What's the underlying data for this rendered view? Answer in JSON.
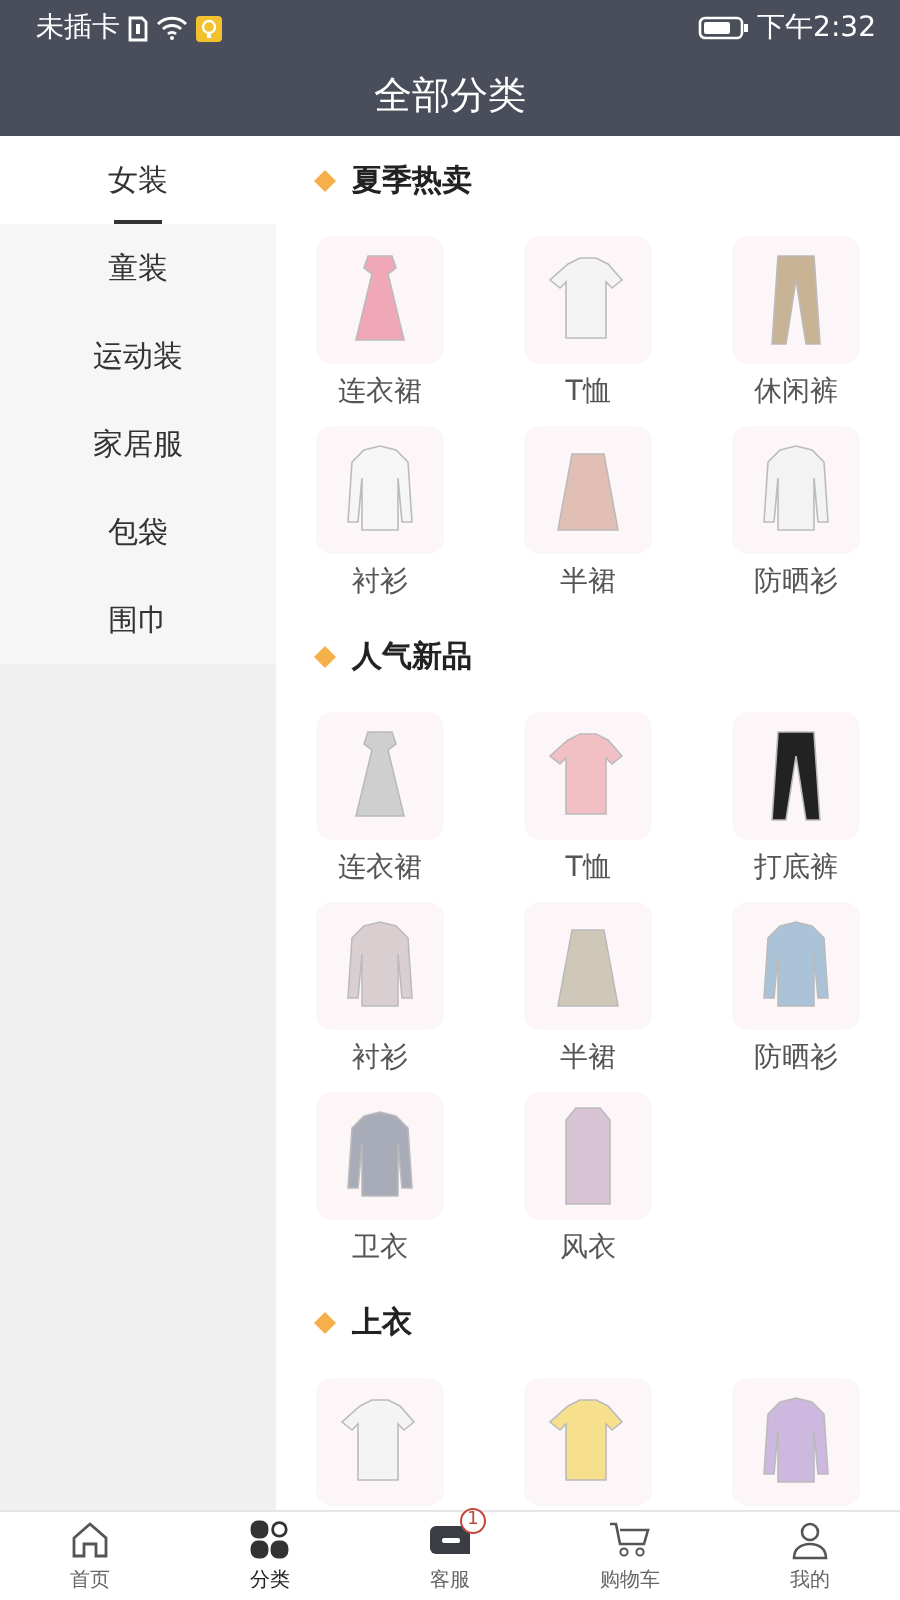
{
  "status_bar": {
    "carrier": "未插卡",
    "time": "下午2:32"
  },
  "header": {
    "title": "全部分类"
  },
  "sidebar": {
    "items": [
      {
        "label": "女装",
        "selected": true
      },
      {
        "label": "童装",
        "selected": false
      },
      {
        "label": "运动装",
        "selected": false
      },
      {
        "label": "家居服",
        "selected": false
      },
      {
        "label": "包袋",
        "selected": false
      },
      {
        "label": "围巾",
        "selected": false
      }
    ]
  },
  "sections": [
    {
      "title": "夏季热卖",
      "items": [
        {
          "label": "连衣裙"
        },
        {
          "label": "T恤"
        },
        {
          "label": "休闲裤"
        },
        {
          "label": "衬衫"
        },
        {
          "label": "半裙"
        },
        {
          "label": "防晒衫"
        }
      ]
    },
    {
      "title": "人气新品",
      "items": [
        {
          "label": "连衣裙"
        },
        {
          "label": "T恤"
        },
        {
          "label": "打底裤"
        },
        {
          "label": "衬衫"
        },
        {
          "label": "半裙"
        },
        {
          "label": "防晒衫"
        },
        {
          "label": "卫衣"
        },
        {
          "label": "风衣"
        }
      ]
    },
    {
      "title": "上衣"
    }
  ],
  "tab_bar": [
    {
      "label": "首页",
      "kind": "home",
      "selected": false
    },
    {
      "label": "分类",
      "kind": "category",
      "selected": true
    },
    {
      "label": "客服",
      "kind": "service",
      "selected": false,
      "badge": "1"
    },
    {
      "label": "购物车",
      "kind": "cart",
      "selected": false
    },
    {
      "label": "我的",
      "kind": "me",
      "selected": false
    }
  ]
}
